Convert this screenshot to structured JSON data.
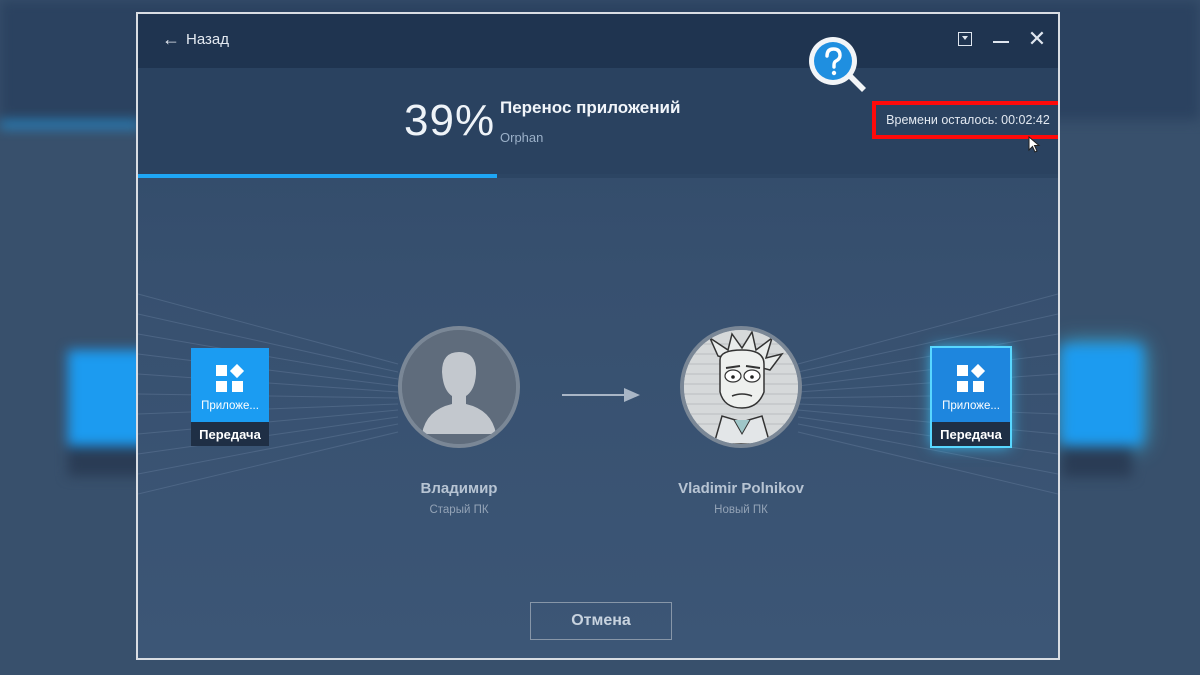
{
  "window": {
    "back_label": "Назад",
    "accent": "#1ea6f5",
    "highlight_color": "#ff0a0a"
  },
  "progress": {
    "percent_text": "39%",
    "value": 0.39,
    "title": "Перенос приложений",
    "subtitle": "Orphan",
    "time_left": "Времени осталось: 00:02:42"
  },
  "source": {
    "tile_label": "Приложе...",
    "tile_caption": "Передача",
    "name": "Владимир",
    "sub": "Старый ПК"
  },
  "target": {
    "tile_label": "Приложе...",
    "tile_caption": "Передача",
    "name": "Vladimir Polnikov",
    "sub": "Новый ПК"
  },
  "actions": {
    "cancel_label": "Отмена"
  },
  "icons": {
    "back": "arrow-left-icon",
    "help": "question-icon",
    "apps": "apps-grid-icon",
    "menu": "dropdown-menu-icon",
    "minimize": "minimize-icon",
    "close": "close-icon",
    "transfer": "arrow-right-icon"
  }
}
